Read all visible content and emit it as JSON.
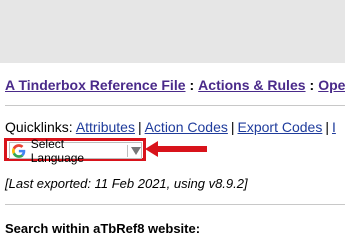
{
  "breadcrumb": {
    "item1": "A Tinderbox Reference File",
    "sep1": ":",
    "item2": "Actions & Rules",
    "sep2": ":",
    "item3": "Oper"
  },
  "quicklinks": {
    "label": "Quicklinks:",
    "links": [
      "Attributes",
      "Action Codes",
      "Export Codes",
      "I"
    ]
  },
  "translate": {
    "label": "Select Language",
    "icon": "google-g-icon",
    "caret": "caret-down-icon"
  },
  "annotation": {
    "color": "#d8131b",
    "type": "arrow-pointing-left"
  },
  "exported_text": "[Last exported: 11 Feb 2021, using v8.9.2]",
  "search_heading": "Search within aTbRef8 website:"
}
